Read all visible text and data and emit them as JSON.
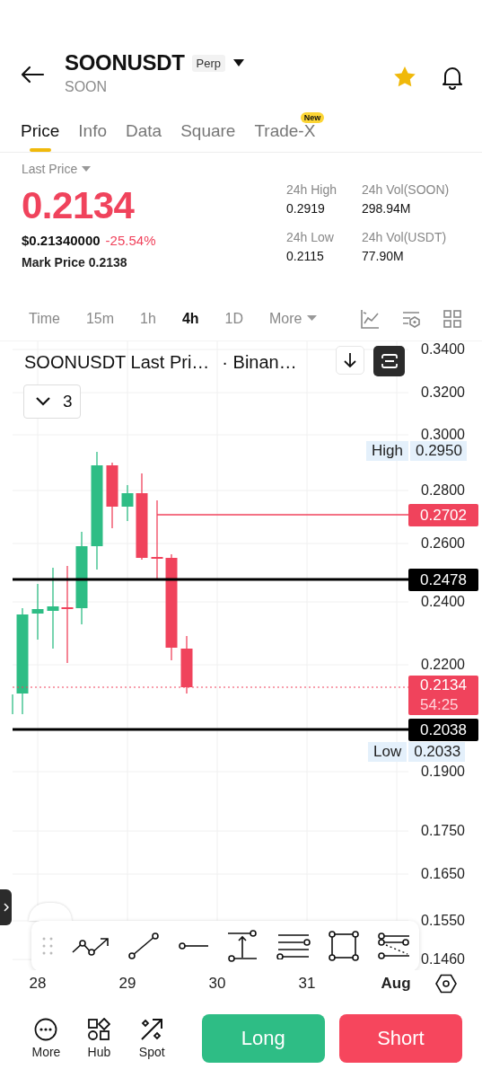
{
  "header": {
    "title": "SOONUSDT",
    "badge": "Perp",
    "subtitle": "SOON",
    "favorite": true
  },
  "tabs": [
    {
      "label": "Price",
      "selected": true
    },
    {
      "label": "Info",
      "selected": false
    },
    {
      "label": "Data",
      "selected": false
    },
    {
      "label": "Square",
      "selected": false
    },
    {
      "label": "Trade-X",
      "selected": false,
      "badge": "New"
    }
  ],
  "price": {
    "label": "Last Price",
    "last": "0.2134",
    "usd": "$0.21340000",
    "change": "-25.54%",
    "mark_label": "Mark Price",
    "mark": "0.2138"
  },
  "stats": [
    {
      "label": "24h High",
      "value": "0.2919"
    },
    {
      "label": "24h Vol(SOON)",
      "value": "298.94M"
    },
    {
      "label": "24h Low",
      "value": "0.2115"
    },
    {
      "label": "24h Vol(USDT)",
      "value": "77.90M"
    }
  ],
  "intervals": [
    {
      "label": "Time",
      "selected": false
    },
    {
      "label": "15m",
      "selected": false
    },
    {
      "label": "1h",
      "selected": false
    },
    {
      "label": "4h",
      "selected": true
    },
    {
      "label": "1D",
      "selected": false
    },
    {
      "label": "More",
      "selected": false,
      "kind": "menu"
    }
  ],
  "chart": {
    "legend": "SOONUSDT Last Pri…",
    "source": "· Binan…",
    "indicator_count": "3",
    "price_ticks": [
      "0.3400",
      "0.3200",
      "0.3000",
      "0.2800",
      "0.2600",
      "0.2400",
      "0.2200",
      "0.1900",
      "0.1750",
      "0.1650",
      "0.1550",
      "0.1460"
    ],
    "markers": [
      {
        "kind": "extreme",
        "label": "High",
        "value": "0.2950"
      },
      {
        "kind": "alert",
        "value": "0.2702",
        "color": "#f0435c"
      },
      {
        "kind": "level",
        "value": "0.2478",
        "color": "#000000"
      },
      {
        "kind": "last",
        "value": "0.2134",
        "countdown": "54:25",
        "color": "#f0435c"
      },
      {
        "kind": "level",
        "value": "0.2038",
        "color": "#000000"
      },
      {
        "kind": "extreme",
        "label": "Low",
        "value": "0.2033"
      }
    ],
    "date_ticks": [
      {
        "label": "28",
        "bold": false
      },
      {
        "label": "29",
        "bold": false
      },
      {
        "label": "30",
        "bold": false
      },
      {
        "label": "31",
        "bold": false
      },
      {
        "label": "Aug",
        "bold": true
      }
    ]
  },
  "bottom_bar": {
    "items": [
      {
        "label": "More",
        "kind": "more"
      },
      {
        "label": "Hub",
        "kind": "hub"
      },
      {
        "label": "Spot",
        "kind": "spot"
      }
    ],
    "buttons": [
      {
        "label": "Long",
        "kind": "long"
      },
      {
        "label": "Short",
        "kind": "short"
      }
    ]
  }
}
